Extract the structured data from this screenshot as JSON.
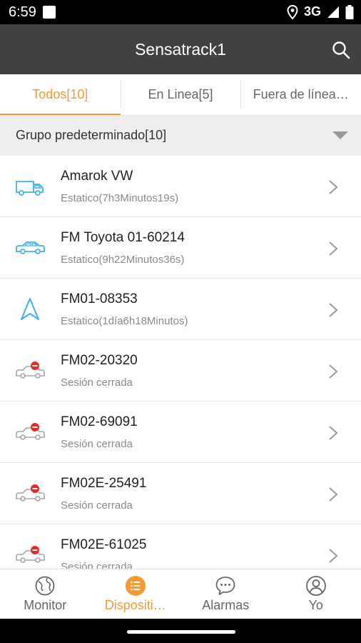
{
  "status_bar": {
    "time": "6:59",
    "network": "3G",
    "icons": [
      "notification-square-icon",
      "location-pin-icon",
      "signal-icon",
      "battery-icon"
    ]
  },
  "header": {
    "title": "Sensatrack1",
    "search_icon": "search-icon"
  },
  "tabs": [
    {
      "label": "Todos[10]",
      "active": true
    },
    {
      "label": "En Linea[5]",
      "active": false
    },
    {
      "label": "Fuera de línea…",
      "active": false
    }
  ],
  "group": {
    "label": "Grupo predeterminado[10]",
    "icon": "caret-down-icon"
  },
  "devices": [
    {
      "name": "Amarok VW",
      "status": "Estatico(7h3Minutos19s)",
      "icon": "truck-icon",
      "state": "static"
    },
    {
      "name": "FM Toyota 01-60214",
      "status": "Estatico(9h22Minutos36s)",
      "icon": "car-icon",
      "state": "static"
    },
    {
      "name": "FM01-08353",
      "status": "Estatico(1día6h18Minutos)",
      "icon": "navigation-arrow-icon",
      "state": "static"
    },
    {
      "name": "FM02-20320",
      "status": "Sesión cerrada",
      "icon": "car-offline-icon",
      "state": "offline"
    },
    {
      "name": "FM02-69091",
      "status": "Sesión cerrada",
      "icon": "car-offline-icon",
      "state": "offline"
    },
    {
      "name": "FM02E-25491",
      "status": "Sesión cerrada",
      "icon": "car-offline-icon",
      "state": "offline"
    },
    {
      "name": "FM02E-61025",
      "status": "Sesión cerrada",
      "icon": "car-offline-icon",
      "state": "offline"
    }
  ],
  "bottom_nav": [
    {
      "label": "Monitor",
      "icon": "monitor-globe-icon",
      "active": false
    },
    {
      "label": "Dispositi…",
      "icon": "device-list-icon",
      "active": true
    },
    {
      "label": "Alarmas",
      "icon": "chat-bubble-icon",
      "active": false
    },
    {
      "label": "Yo",
      "icon": "user-icon",
      "active": false
    }
  ],
  "colors": {
    "accent": "#f39a35",
    "header_bg": "#414141",
    "static_icon": "#3fb2e4",
    "offline_icon": "#a6a6a6",
    "offline_badge": "#e32b2b"
  }
}
